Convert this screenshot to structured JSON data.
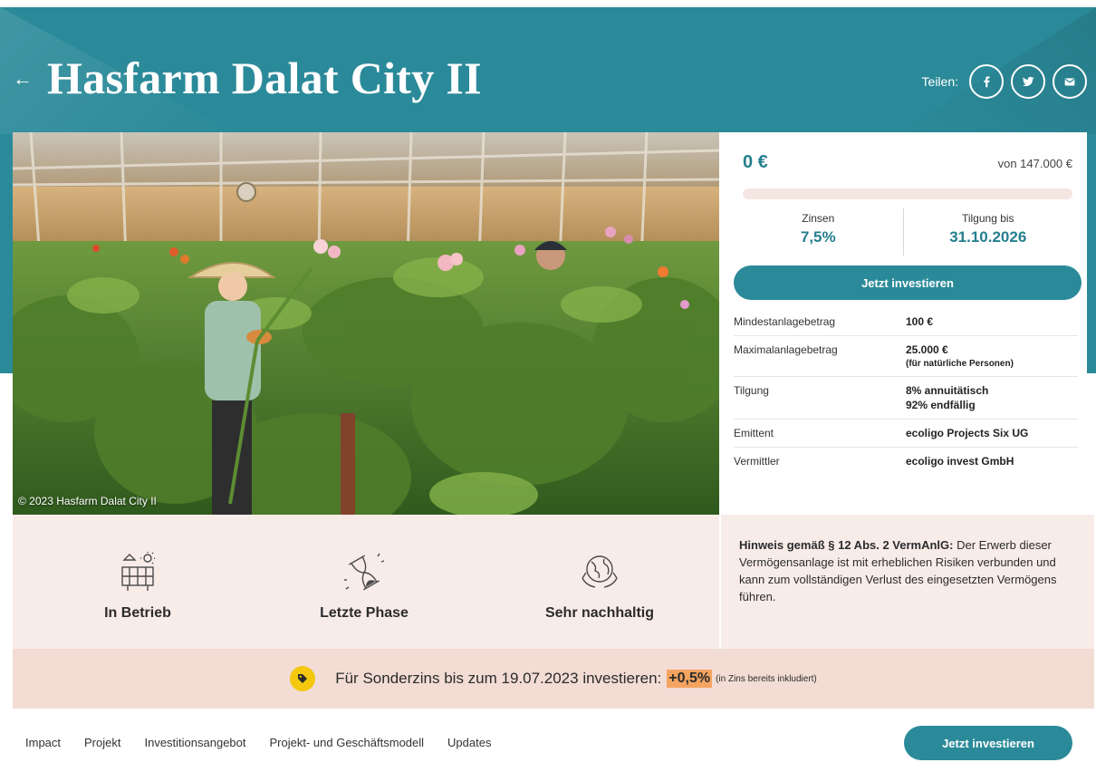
{
  "header": {
    "back_icon": "arrow-left-icon",
    "title": "Hasfarm Dalat City II",
    "share_label": "Teilen:",
    "share_icons": [
      "facebook-icon",
      "twitter-icon",
      "email-icon"
    ]
  },
  "hero": {
    "caption": "© 2023 Hasfarm Dalat City II"
  },
  "funding": {
    "amount": "0 €",
    "target": "von 147.000 €",
    "progress": 0,
    "interest_label": "Zinsen",
    "interest_value": "7,5%",
    "repayment_label": "Tilgung bis",
    "repayment_value": "31.10.2026",
    "invest_button": "Jetzt investieren"
  },
  "details": [
    {
      "label": "Mindestanlagebetrag",
      "value": "100 €",
      "sub": ""
    },
    {
      "label": "Maximalanlagebetrag",
      "value": "25.000 €",
      "sub": "(für natürliche Personen)"
    },
    {
      "label": "Tilgung",
      "value": "8% annuitätisch",
      "sub": "92% endfällig"
    },
    {
      "label": "Emittent",
      "value": "ecoligo Projects Six UG",
      "sub": ""
    },
    {
      "label": "Vermittler",
      "value": "ecoligo invest GmbH",
      "sub": ""
    }
  ],
  "features": [
    {
      "icon": "solar-panel-icon",
      "label": "In Betrieb"
    },
    {
      "icon": "hourglass-icon",
      "label": "Letzte Phase"
    },
    {
      "icon": "globe-hands-icon",
      "label": "Sehr nachhaltig"
    }
  ],
  "notice": {
    "heading": "Hinweis gemäß § 12 Abs. 2 VermAnlG:",
    "text": "Der Erwerb dieser Vermögensanlage ist mit erheblichen Risiken verbunden und kann zum vollständigen Verlust des eingesetzten Vermögens führen."
  },
  "promo": {
    "icon": "tag-icon",
    "text": "Für Sonderzins bis zum 19.07.2023 investieren:",
    "highlight": "+0,5%",
    "note": "(in Zins bereits inkludiert)"
  },
  "nav": {
    "items": [
      "Impact",
      "Projekt",
      "Investitionsangebot",
      "Projekt- und Geschäftsmodell",
      "Updates"
    ],
    "button": "Jetzt investieren"
  },
  "colors": {
    "brand_teal": "#2b8a99",
    "cream": "#f8ece9",
    "promo_bg": "#f2dcd4",
    "highlight": "#f4a460",
    "tag_yellow": "#f3c80f"
  }
}
